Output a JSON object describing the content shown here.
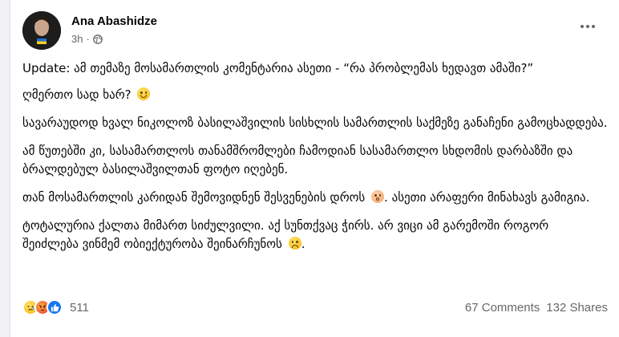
{
  "post": {
    "author": "Ana Abashidze",
    "time": "3h",
    "audience_icon": "globe-icon",
    "paragraphs": [
      {
        "text": "Update: ამ თემაზე მოსამართლის კომენტარია ასეთი - “რა პრობლემას ხედავთ ამაში?”",
        "emoji": null
      },
      {
        "text": "ღმერთო სად ხარ?",
        "emoji": "smiling-face-with-tear"
      },
      {
        "text": "სავარაუდოდ ხვალ ნიკოლოზ ბასილაშვილის სისხლის სამართლის საქმეზე განაჩენი გამოცხადდება.",
        "emoji": null
      },
      {
        "text": "ამ წუთებში კი, სასამართლოს თანამშრომლები ჩამოდიან სასამართლო სხდომის დარბაზში და ბრალდებულ ბასილაშვილთან ფოტო იღებენ.",
        "emoji": null
      },
      {
        "text": "თან მოსამართლის კარიდან შემოვიდნენ შესვენების დროს",
        "emoji": "flushed-face",
        "text_after": ". ასეთი არაფერი მინახავს გამიგია."
      },
      {
        "text": "ტოტალურია ქალთა მიმართ სიძულვილი. აქ სუნთქვაც ჭირს. არ ვიცი ამ გარემოში როგორ შეიძლება ვინმემ ობიექტურობა შეინარჩუნოს",
        "emoji": "disappointed-face",
        "text_after": "."
      }
    ]
  },
  "footer": {
    "reaction_icons": [
      "sad-reaction-icon",
      "angry-reaction-icon",
      "like-reaction-icon"
    ],
    "reaction_count": "511",
    "comments": "67 Comments",
    "shares": "132 Shares"
  },
  "colors": {
    "like_blue": "#1877f2",
    "secondary_text": "#65676b"
  }
}
